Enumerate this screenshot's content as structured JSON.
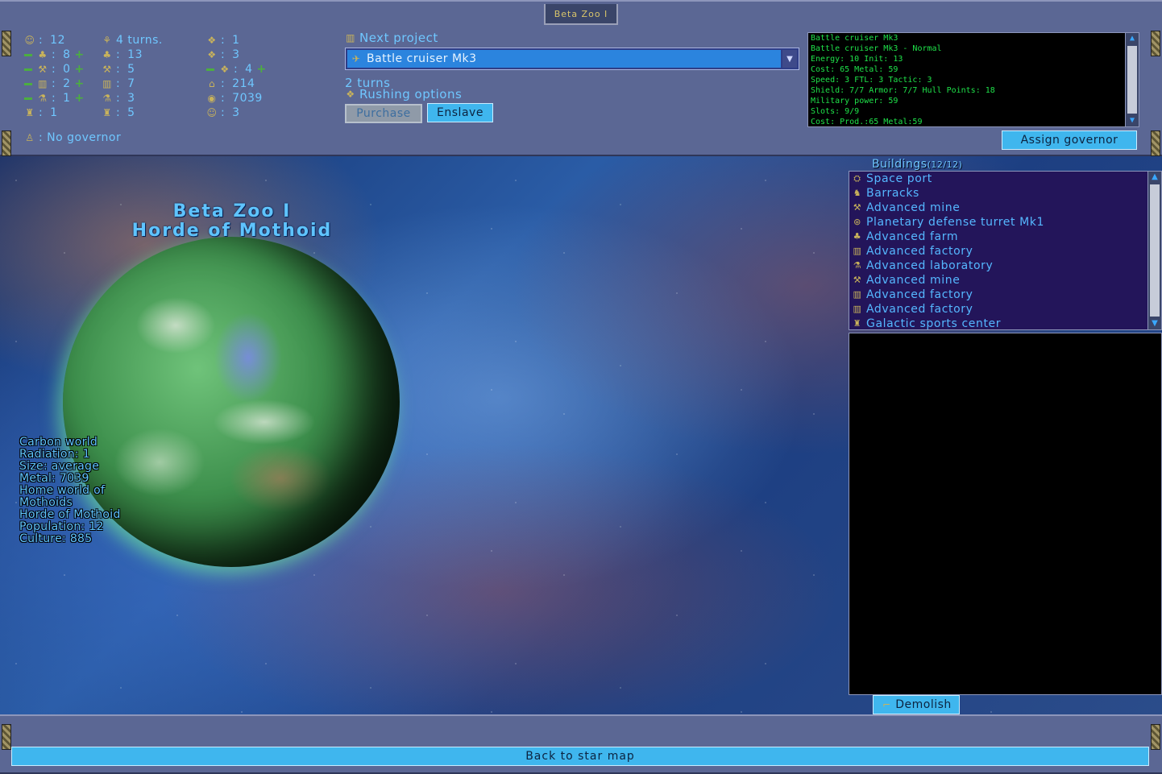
{
  "window_title": "Beta Zoo I",
  "stats": {
    "population": "12",
    "growth": "4 turns.",
    "food": "8",
    "food_total": "13",
    "mining": "0",
    "mining_total": "5",
    "industry": "2",
    "industry_total": "7",
    "research": "1",
    "research_total": "3",
    "sports": "1",
    "sports_total": "5",
    "col3_row1": "1",
    "col3_row2": "3",
    "col3_row3": "4",
    "col3_row4": "214",
    "metal": "7039",
    "happiness": "3"
  },
  "governor": {
    "label": ": No governor",
    "assign_button": "Assign governor"
  },
  "production": {
    "next_project_label": "Next project",
    "selected_project": "Battle cruiser Mk3",
    "turns": "2 turns",
    "rushing_label": "Rushing options",
    "purchase_button": "Purchase",
    "enslave_button": "Enslave"
  },
  "ship_info": [
    "Battle cruiser Mk3",
    "Battle cruiser Mk3 - Normal",
    "Energy: 10 Init: 13",
    "Cost: 65 Metal: 59",
    "Speed: 3 FTL: 3 Tactic: 3",
    "Shield: 7/7 Armor: 7/7 Hull Points: 18",
    "Military power: 59",
    "Slots: 9/9",
    "Cost: Prod.:65 Metal:59"
  ],
  "planet": {
    "name": "Beta Zoo I",
    "owner": "Horde of Mothoid",
    "info": [
      "Carbon world",
      "Radiation: 1",
      "Size: average",
      "Metal: 7039",
      "Home world of",
      "Mothoids",
      "Horde of Mothoid",
      "Population: 12",
      "Culture: 885"
    ]
  },
  "buildings": {
    "title": "Buildings",
    "count": "(12/12)",
    "items": [
      {
        "label": "Space port",
        "icon": "space-port-icon"
      },
      {
        "label": "Barracks",
        "icon": "barracks-icon"
      },
      {
        "label": "Advanced mine",
        "icon": "pickaxe-icon"
      },
      {
        "label": "Planetary defense turret Mk1",
        "icon": "turret-icon"
      },
      {
        "label": "Advanced farm",
        "icon": "tree-icon"
      },
      {
        "label": "Advanced factory",
        "icon": "factory-icon"
      },
      {
        "label": "Advanced laboratory",
        "icon": "flask-icon"
      },
      {
        "label": "Advanced mine",
        "icon": "pickaxe-icon"
      },
      {
        "label": "Advanced factory",
        "icon": "factory-icon"
      },
      {
        "label": "Advanced factory",
        "icon": "factory-icon"
      },
      {
        "label": "Galactic sports center",
        "icon": "stadium-icon"
      }
    ],
    "demolish_button": "Demolish"
  },
  "back_button": "Back to star map",
  "colors": {
    "panel": "#5b6794",
    "accent_button": "#3fb6ee",
    "text_cyan": "#6fc7ff",
    "info_text": "#1fe24a"
  }
}
